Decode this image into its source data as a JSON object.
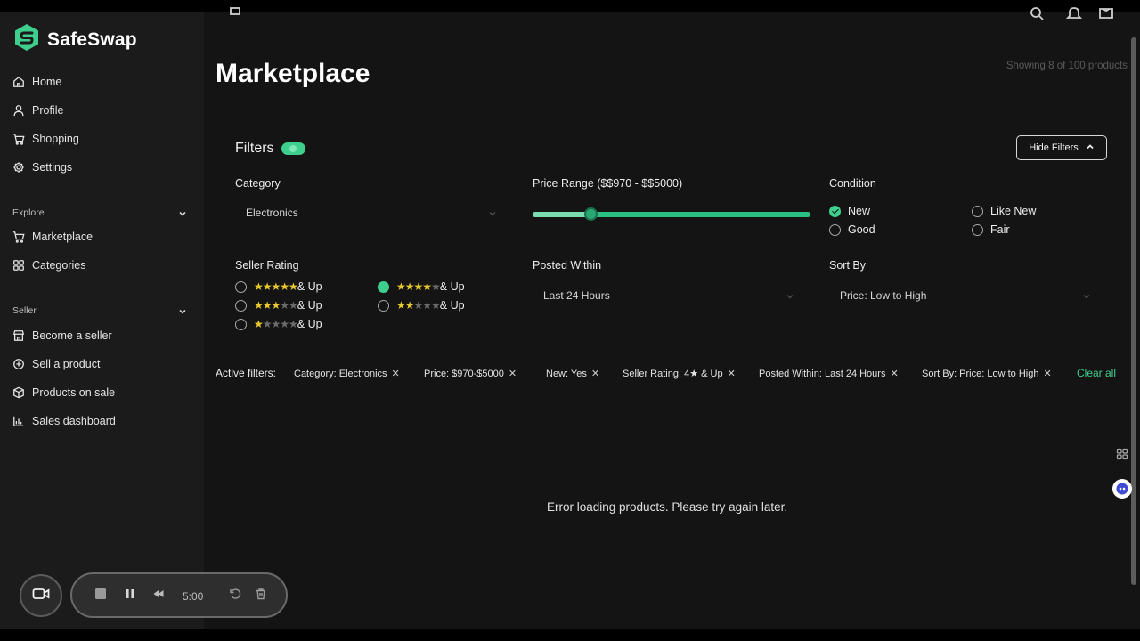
{
  "app": {
    "name": "SafeSwap",
    "brand_color": "#3ecf8e"
  },
  "sidebar": {
    "main_items": [
      {
        "label": "Home",
        "icon": "home-icon"
      },
      {
        "label": "Profile",
        "icon": "user-icon"
      },
      {
        "label": "Shopping",
        "icon": "cart-icon"
      },
      {
        "label": "Settings",
        "icon": "gear-icon"
      }
    ],
    "explore": {
      "label": "Explore",
      "items": [
        {
          "label": "Marketplace",
          "icon": "cart-icon"
        },
        {
          "label": "Categories",
          "icon": "grid-icon"
        }
      ]
    },
    "seller": {
      "label": "Seller",
      "items": [
        {
          "label": "Become a seller",
          "icon": "store-icon"
        },
        {
          "label": "Sell a product",
          "icon": "plus-circle-icon"
        },
        {
          "label": "Products on sale",
          "icon": "box-icon"
        },
        {
          "label": "Sales dashboard",
          "icon": "bar-chart-icon"
        }
      ]
    }
  },
  "header": {
    "title": "Marketplace",
    "showing": "Showing 8 of 100 products"
  },
  "filters": {
    "title": "Filters",
    "hide_label": "Hide Filters",
    "category": {
      "label": "Category",
      "value": "Electronics"
    },
    "price": {
      "label": "Price Range ($$970 - $$5000)",
      "min": 970,
      "max": 5000
    },
    "condition": {
      "label": "Condition",
      "options": [
        {
          "label": "New",
          "checked": true
        },
        {
          "label": "Like New",
          "checked": false
        },
        {
          "label": "Good",
          "checked": false
        },
        {
          "label": "Fair",
          "checked": false
        }
      ]
    },
    "seller_rating": {
      "label": "Seller Rating",
      "suffix": "& Up",
      "options": [
        {
          "stars": 5,
          "checked": false
        },
        {
          "stars": 4,
          "checked": true
        },
        {
          "stars": 3,
          "checked": false
        },
        {
          "stars": 2,
          "checked": false
        },
        {
          "stars": 1,
          "checked": false
        }
      ]
    },
    "posted_within": {
      "label": "Posted Within",
      "value": "Last 24 Hours"
    },
    "sort_by": {
      "label": "Sort By",
      "value": "Price: Low to High"
    }
  },
  "active_filters": {
    "label": "Active filters:",
    "chips": [
      "Category: Electronics",
      "Price: $970-$5000",
      "New: Yes",
      "Seller Rating: 4★ & Up",
      "Posted Within: Last 24 Hours",
      "Sort By: Price: Low to High"
    ],
    "clear_label": "Clear all"
  },
  "content": {
    "error": "Error loading products. Please try again later."
  },
  "recorder": {
    "time": "5:00"
  }
}
